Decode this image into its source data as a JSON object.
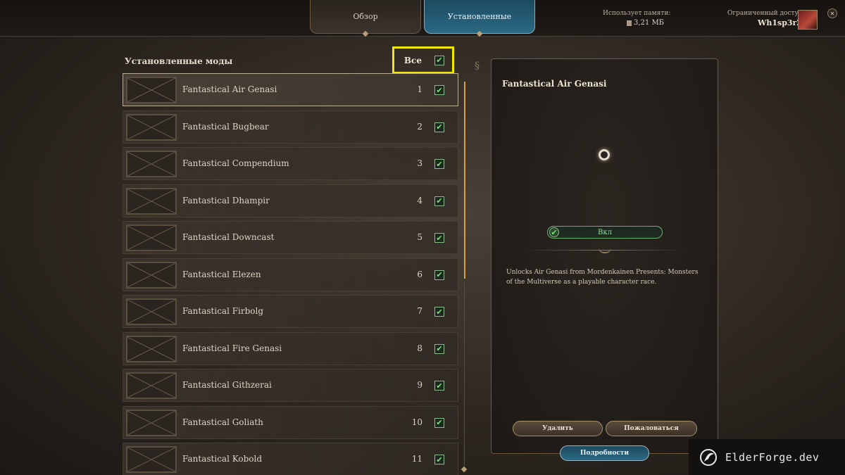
{
  "tabs": [
    {
      "label": "Обзор",
      "active": false
    },
    {
      "label": "Установленные",
      "active": true
    }
  ],
  "memory": {
    "label": "Использует памяти:",
    "value": "3,21 МБ"
  },
  "account": {
    "access_label": "Ограниченный доступ",
    "username": "Wh1sp3rZ"
  },
  "mod_list": {
    "title": "Установленные моды",
    "select_all_label": "Все",
    "select_all_checked": true,
    "items": [
      {
        "name": "Fantastical Air Genasi",
        "order": "1",
        "checked": true,
        "selected": true
      },
      {
        "name": "Fantastical Bugbear",
        "order": "2",
        "checked": true
      },
      {
        "name": "Fantastical Compendium",
        "order": "3",
        "checked": true
      },
      {
        "name": "Fantastical Dhampir",
        "order": "4",
        "checked": true
      },
      {
        "name": "Fantastical Downcast",
        "order": "5",
        "checked": true
      },
      {
        "name": "Fantastical Elezen",
        "order": "6",
        "checked": true
      },
      {
        "name": "Fantastical Firbolg",
        "order": "7",
        "checked": true
      },
      {
        "name": "Fantastical Fire Genasi",
        "order": "8",
        "checked": true
      },
      {
        "name": "Fantastical Githzerai",
        "order": "9",
        "checked": true
      },
      {
        "name": "Fantastical Goliath",
        "order": "10",
        "checked": true
      },
      {
        "name": "Fantastical Kobold",
        "order": "11",
        "checked": true
      }
    ]
  },
  "detail": {
    "title": "Fantastical Air Genasi",
    "toggle_label": "Вкл",
    "description": "Unlocks Air Genasi from Mordenkainen Presents: Monsters of the Multiverse as a playable character race.",
    "delete_label": "Удалить",
    "report_label": "Пожаловаться",
    "details_label": "Подробности"
  },
  "watermark": {
    "text": "ElderForge.dev"
  },
  "colors": {
    "accent_teal": "#2a6a84",
    "check_green": "#7ee07a",
    "highlight_yellow": "#f3e600"
  }
}
